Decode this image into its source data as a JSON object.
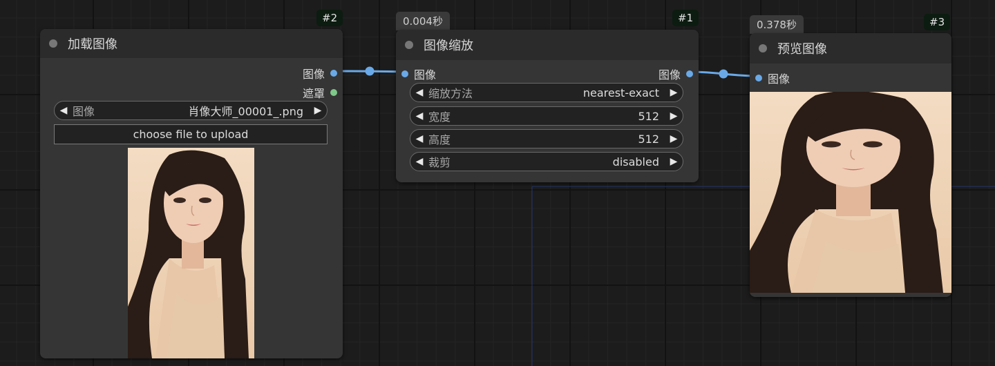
{
  "colors": {
    "image_slot": "#6aa9e8",
    "mask_slot": "#7fc98a",
    "link": "#6aa9e8",
    "badge_bg": "#0c1c10"
  },
  "load_image_node": {
    "id_badge": "#2",
    "title": "加载图像",
    "outputs": {
      "image": "图像",
      "mask": "遮罩"
    },
    "image_widget": {
      "name": "图像",
      "value": "肖像大师_00001_.png"
    },
    "upload_button": "choose file to upload",
    "preview": "portrait-photo"
  },
  "scale_node": {
    "id_badge": "#1",
    "timing": "0.004秒",
    "title": "图像缩放",
    "input": "图像",
    "output": "图像",
    "widgets": [
      {
        "name": "缩放方法",
        "value": "nearest-exact"
      },
      {
        "name": "宽度",
        "value": "512"
      },
      {
        "name": "高度",
        "value": "512"
      },
      {
        "name": "裁剪",
        "value": "disabled"
      }
    ]
  },
  "preview_node": {
    "id_badge": "#3",
    "timing": "0.378秒",
    "title": "预览图像",
    "input": "图像",
    "preview": "portrait-photo"
  },
  "icons": {
    "collapse": "collapse-dot-icon",
    "decrement": "left-triangle-icon",
    "increment": "right-triangle-icon"
  }
}
